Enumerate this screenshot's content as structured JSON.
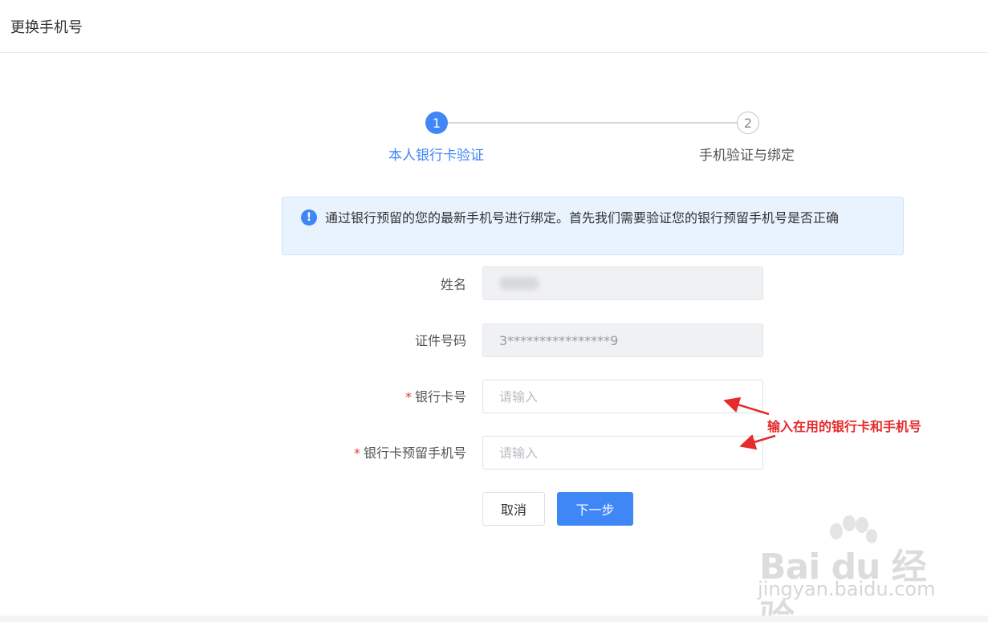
{
  "header": {
    "title": "更换手机号"
  },
  "steps": [
    {
      "number": "1",
      "label": "本人银行卡验证",
      "state": "active"
    },
    {
      "number": "2",
      "label": "手机验证与绑定",
      "state": "pending"
    }
  ],
  "notice": {
    "icon": "info-icon",
    "text": "通过银行预留的您的最新手机号进行绑定。首先我们需要验证您的银行预留手机号是否正确"
  },
  "form": {
    "name": {
      "label": "姓名"
    },
    "id_number": {
      "label": "证件号码",
      "value": "3****************9"
    },
    "bank_card": {
      "required_mark": "*",
      "label": "银行卡号",
      "placeholder": "请输入"
    },
    "bank_phone": {
      "required_mark": "*",
      "label": "银行卡预留手机号",
      "placeholder": "请输入"
    }
  },
  "buttons": {
    "cancel": "取消",
    "next": "下一步"
  },
  "annotation": {
    "text": "输入在用的银行卡和手机号",
    "color": "#e52b2b"
  },
  "watermark": {
    "brand": "Bai du 经验",
    "url": "jingyan.baidu.com"
  },
  "colors": {
    "primary": "#3f86f7",
    "notice_bg": "#e8f3fe"
  }
}
